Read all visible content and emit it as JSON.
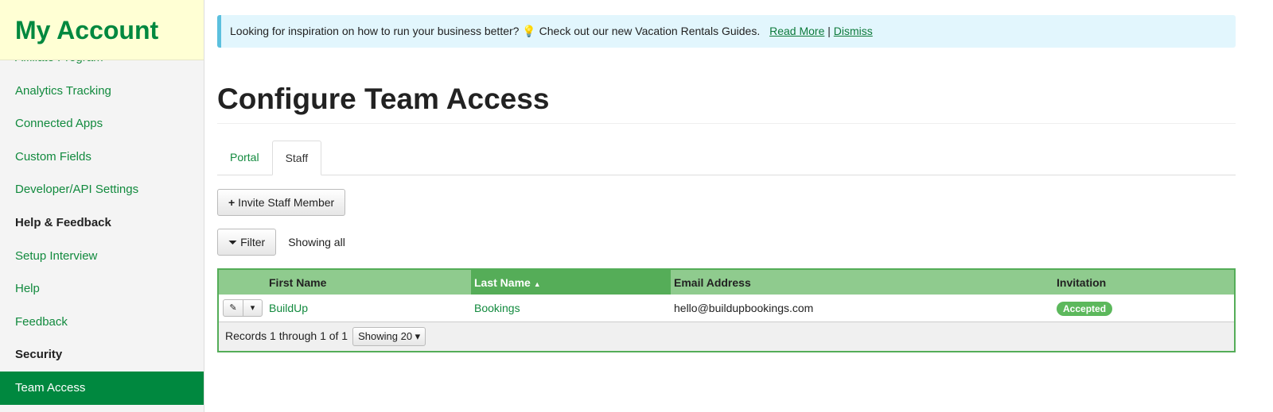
{
  "sidebar": {
    "title": "My Account",
    "items": [
      {
        "label": "Affiliate Program",
        "type": "link"
      },
      {
        "label": "Analytics Tracking",
        "type": "link"
      },
      {
        "label": "Connected Apps",
        "type": "link"
      },
      {
        "label": "Custom Fields",
        "type": "link"
      },
      {
        "label": "Developer/API Settings",
        "type": "link"
      },
      {
        "label": "Help & Feedback",
        "type": "header"
      },
      {
        "label": "Setup Interview",
        "type": "link"
      },
      {
        "label": "Help",
        "type": "link"
      },
      {
        "label": "Feedback",
        "type": "link"
      },
      {
        "label": "Security",
        "type": "header"
      },
      {
        "label": "Team Access",
        "type": "active"
      }
    ]
  },
  "alert": {
    "text": "Looking for inspiration on how to run your business better? 💡 Check out our new Vacation Rentals Guides.",
    "read_more": "Read More",
    "sep": "|",
    "dismiss": "Dismiss"
  },
  "page_title": "Configure Team Access",
  "tabs": [
    {
      "label": "Portal"
    },
    {
      "label": "Staff",
      "active": true
    }
  ],
  "invite_label": "Invite Staff Member",
  "filter_label": "Filter",
  "showing_text": "Showing all",
  "table": {
    "headers": [
      "First Name",
      "Last Name",
      "Email Address",
      "Invitation"
    ],
    "sort_indicator": "▲",
    "rows": [
      {
        "first": "BuildUp",
        "last": "Bookings",
        "email": "hello@buildupbookings.com",
        "invitation": "Accepted"
      }
    ],
    "records": "Records 1 through 1 of 1",
    "page_size": "Showing 20"
  },
  "colors": {
    "brand": "#00883f",
    "header_bg": "#8fcb8e",
    "sorted_header": "#55ad58",
    "badge": "#5cb85c"
  }
}
